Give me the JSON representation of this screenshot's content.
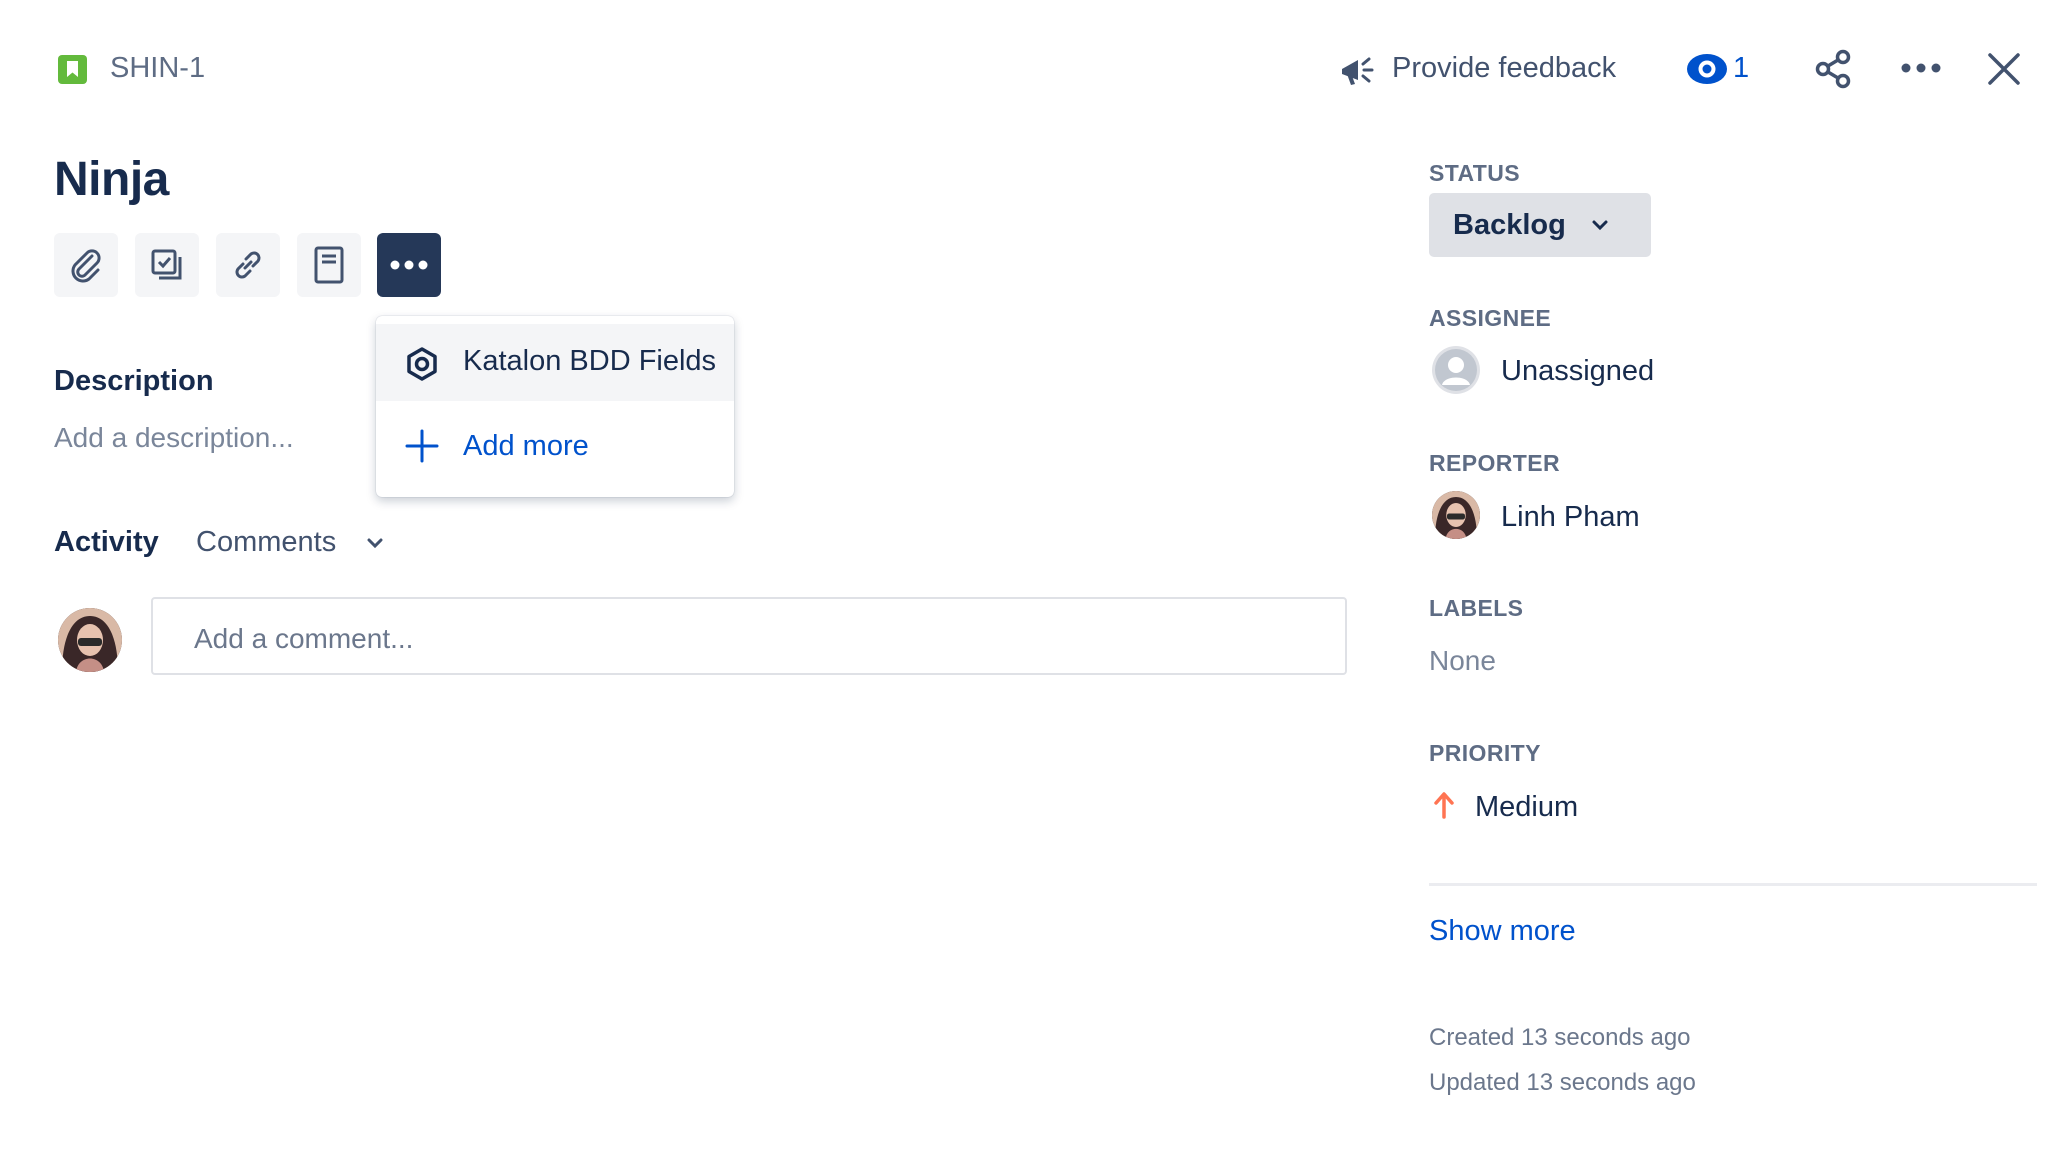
{
  "header": {
    "issue_key": "SHIN-1",
    "issue_type_icon": "story-bookmark-icon",
    "feedback_label": "Provide feedback",
    "watch_count": "1",
    "icons": [
      "megaphone-icon",
      "eye-icon",
      "share-icon",
      "more-icon",
      "close-icon"
    ]
  },
  "issue": {
    "title": "Ninja"
  },
  "toolbar": {
    "buttons": [
      "attachment-icon",
      "subtask-icon",
      "link-icon",
      "page-icon",
      "more-icon"
    ]
  },
  "menu": {
    "items": [
      {
        "label": "Katalon BDD Fields",
        "icon": "hexagon-icon"
      },
      {
        "label": "Add more",
        "icon": "plus-icon"
      }
    ]
  },
  "description": {
    "heading": "Description",
    "placeholder": "Add a description..."
  },
  "activity": {
    "heading": "Activity",
    "filter": "Comments",
    "comment_placeholder": "Add a comment..."
  },
  "fields": {
    "status": {
      "label": "STATUS",
      "value": "Backlog"
    },
    "assignee": {
      "label": "ASSIGNEE",
      "value": "Unassigned"
    },
    "reporter": {
      "label": "REPORTER",
      "value": "Linh Pham"
    },
    "labels": {
      "label": "LABELS",
      "value": "None"
    },
    "priority": {
      "label": "PRIORITY",
      "value": "Medium"
    }
  },
  "show_more": "Show more",
  "meta": {
    "created": "Created 13 seconds ago",
    "updated": "Updated 13 seconds ago"
  },
  "colors": {
    "brand_blue": "#0052cc",
    "dark_navy": "#253858",
    "story_green": "#63ba3c",
    "priority_orange": "#ff7452"
  }
}
